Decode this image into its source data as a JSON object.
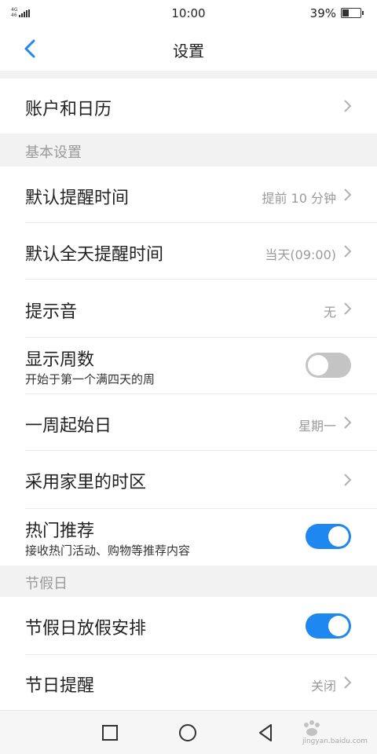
{
  "status_bar": {
    "network": "4G",
    "network_sub": "46",
    "time": "10:00",
    "battery_percent": "39%",
    "battery_level": 0.39
  },
  "header": {
    "back_icon": "chevron-left-icon",
    "title": "设置"
  },
  "rows": {
    "account": {
      "label": "账户和日历"
    },
    "default_reminder": {
      "label": "默认提醒时间",
      "value": "提前 10 分钟"
    },
    "allday_reminder": {
      "label": "默认全天提醒时间",
      "value": "当天(09:00)"
    },
    "sound": {
      "label": "提示音",
      "value": "无"
    },
    "week_numbers": {
      "label": "显示周数",
      "sub": "开始于第一个满四天的周",
      "enabled": false
    },
    "week_start": {
      "label": "一周起始日",
      "value": "星期一"
    },
    "home_timezone": {
      "label": "采用家里的时区"
    },
    "hot_recommend": {
      "label": "热门推荐",
      "sub": "接收热门活动、购物等推荐内容",
      "enabled": true
    },
    "holiday_schedule": {
      "label": "节假日放假安排",
      "enabled": true
    },
    "festival_reminder": {
      "label": "节日提醒",
      "value": "关闭"
    }
  },
  "sections": {
    "basic": "基本设置",
    "holiday": "节假日"
  },
  "nav_bar": {
    "recent_icon": "square-icon",
    "home_icon": "circle-icon",
    "back_icon": "triangle-back-icon"
  },
  "watermark": {
    "text": "jingyan.baidu.com"
  },
  "colors": {
    "accent": "#1e88f0",
    "toggle_off": "#c4c4c4",
    "secondary_text": "#9a9a9a"
  }
}
